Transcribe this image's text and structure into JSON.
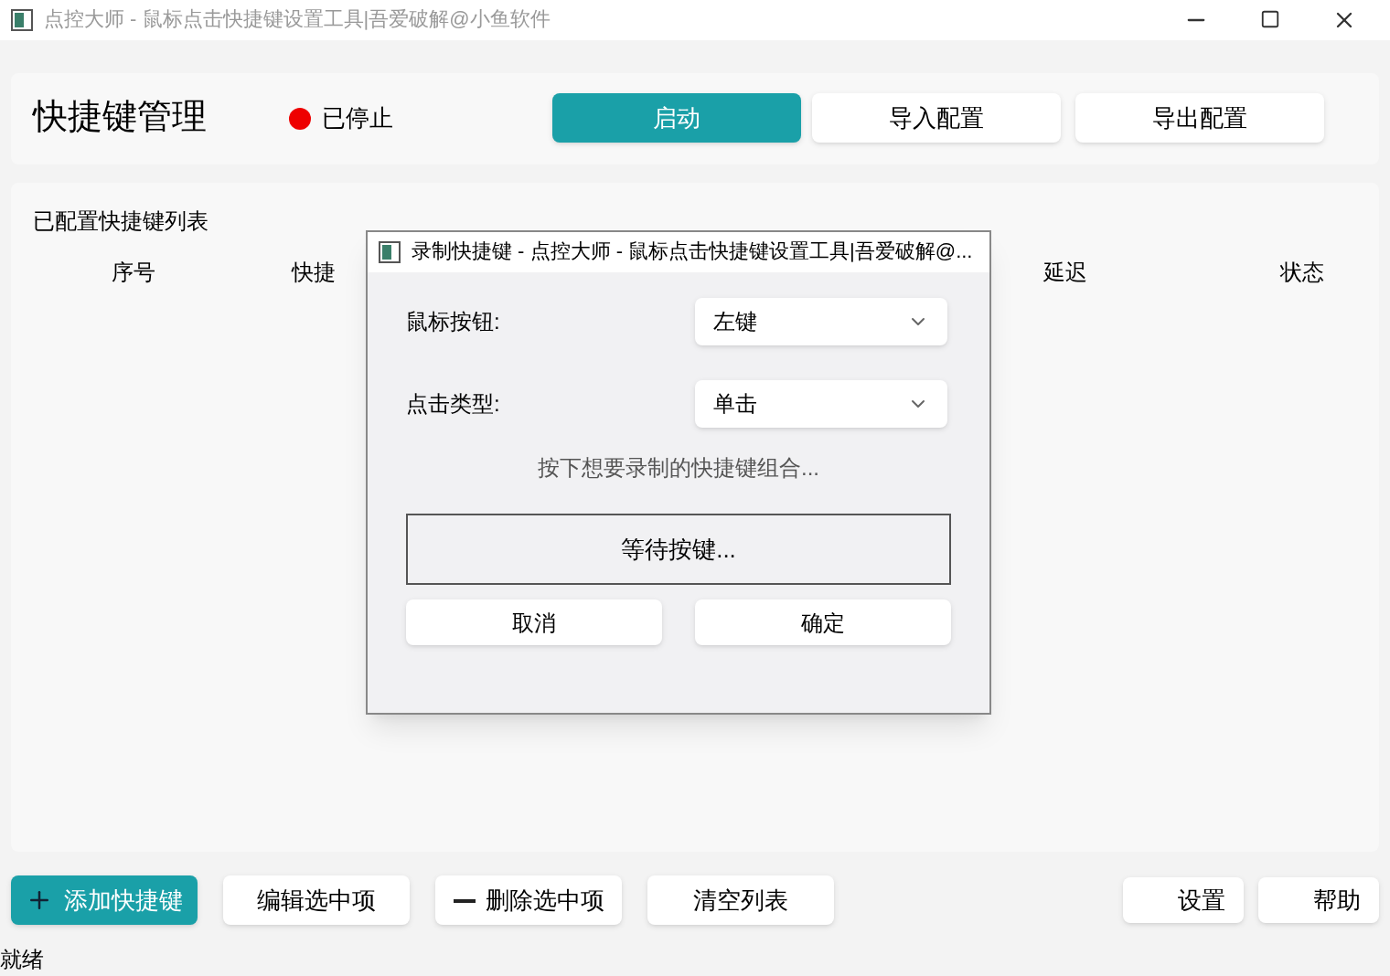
{
  "window": {
    "title": "点控大师 - 鼠标点击快捷键设置工具|吾爱破解@小鱼软件"
  },
  "header": {
    "title": "快捷键管理",
    "status": {
      "label": "已停止",
      "color": "#ee0000"
    },
    "buttons": [
      {
        "label": "启动",
        "primary": true
      },
      {
        "label": "导入配置",
        "primary": false
      },
      {
        "label": "导出配置",
        "primary": false
      }
    ]
  },
  "list": {
    "title": "已配置快捷键列表",
    "columns": [
      {
        "label": "序号"
      },
      {
        "label": "快捷"
      },
      {
        "label": "延迟"
      },
      {
        "label": "状态"
      }
    ]
  },
  "dialog": {
    "title": "录制快捷键 - 点控大师 - 鼠标点击快捷键设置工具|吾爱破解@...",
    "fields": [
      {
        "label": "鼠标按钮:",
        "value": "左键"
      },
      {
        "label": "点击类型:",
        "value": "单击"
      }
    ],
    "hint": "按下想要录制的快捷键组合...",
    "record_button": "等待按键...",
    "buttons": [
      "取消",
      "确定"
    ]
  },
  "toolbar": [
    {
      "label": "添加快捷键",
      "kind": "add",
      "primary": true
    },
    {
      "label": "编辑选中项",
      "kind": "plain",
      "primary": false
    },
    {
      "label": "删除选中项",
      "kind": "remove",
      "primary": false
    },
    {
      "label": "清空列表",
      "kind": "plain",
      "primary": false
    }
  ],
  "toolbar_right": [
    "设置",
    "帮助"
  ],
  "status_bar": "就绪"
}
